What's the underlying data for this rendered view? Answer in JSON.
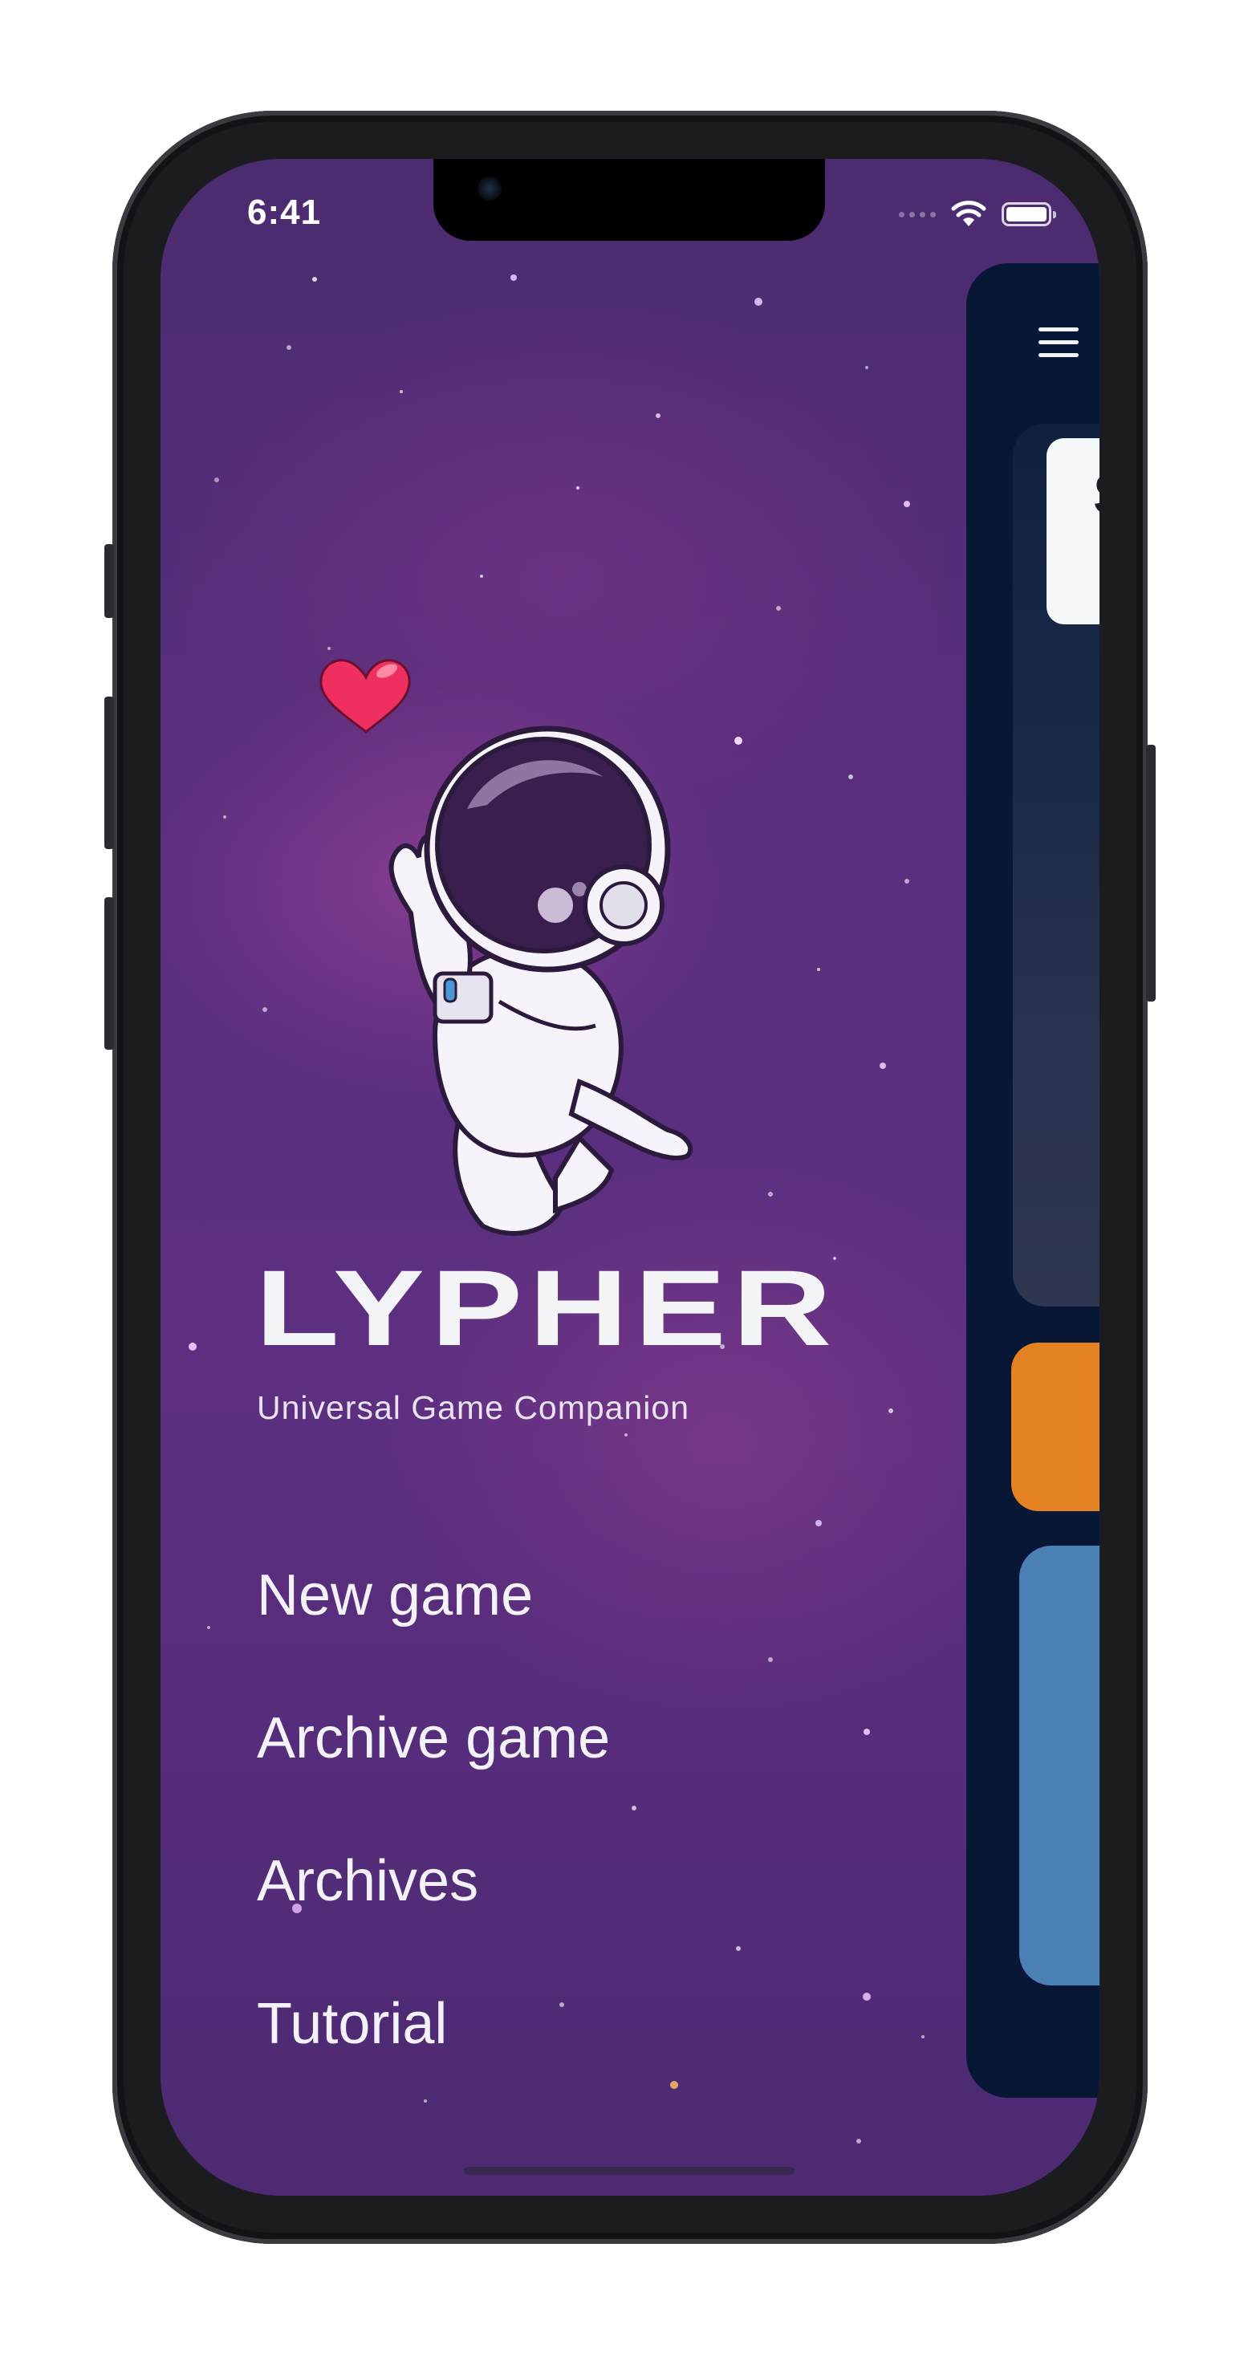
{
  "status_bar": {
    "time": "6:41",
    "battery_level": 1.0
  },
  "app": {
    "title": "LYPHER",
    "subtitle": "Universal Game Companion"
  },
  "menu": {
    "items": [
      {
        "label": "New game"
      },
      {
        "label": "Archive game"
      },
      {
        "label": "Archives"
      },
      {
        "label": "Tutorial"
      }
    ]
  },
  "drawer_preview": {
    "menu_icon": "hamburger-icon",
    "card_letter": "S"
  },
  "colors": {
    "background_purple": "#5a2f7e",
    "drawer_panel": "#081735",
    "orange_card": "#e48224",
    "blue_card": "#4a80b4",
    "heart": "#ef2f5f"
  },
  "icons": [
    "wifi-icon",
    "battery-icon",
    "hamburger-icon",
    "heart-icon",
    "astronaut-mascot"
  ]
}
